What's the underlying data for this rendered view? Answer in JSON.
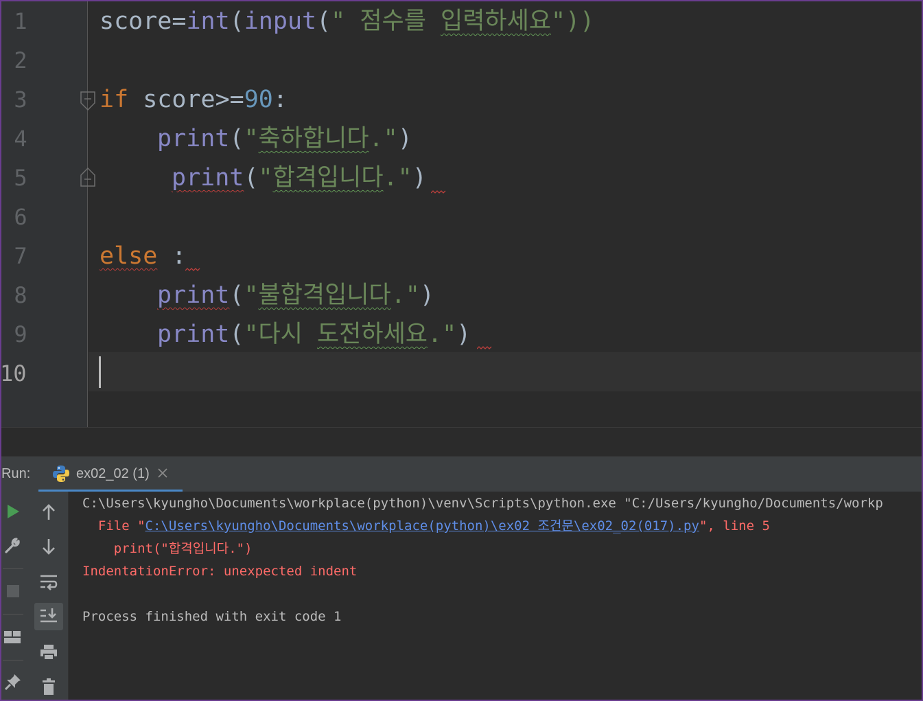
{
  "editor": {
    "line_numbers": [
      "1",
      "2",
      "3",
      "4",
      "5",
      "6",
      "7",
      "8",
      "9",
      "10"
    ],
    "current_line": "10",
    "lines": {
      "l1": {
        "a": "score=",
        "b": "int",
        "c": "(",
        "d": "input",
        "e": "(",
        "f": "\" 점수를 ",
        "g": "입력하세요",
        "h": "\"))"
      },
      "l3": {
        "a": "if",
        "b": " score>=",
        "c": "90",
        "d": ":"
      },
      "l4": {
        "a": "print",
        "b": "(",
        "c": "\"",
        "d": "축하합니다",
        "e": ".\"",
        "f": ")"
      },
      "l5": {
        "a": "print",
        "b": "(",
        "c": "\"",
        "d": "합격입니다",
        "e": ".\"",
        "f": ")"
      },
      "l7": {
        "a": "else",
        "b": " ",
        "c": ":"
      },
      "l8": {
        "a": "print",
        "b": "(",
        "c": "\"",
        "d": "불합격입니다",
        "e": ".\"",
        "f": ")"
      },
      "l9": {
        "a": "print",
        "b": "(",
        "c": "\"다시 ",
        "d": "도전하세요",
        "e": ".\"",
        "f": ")"
      }
    }
  },
  "run_panel": {
    "label": "Run:",
    "tab_label": "ex02_02 (1)",
    "icons": {
      "rerun": "play-icon",
      "settings": "wrench-icon",
      "stop": "stop-icon",
      "layout": "layout-icon",
      "pin": "pin-icon",
      "up": "arrow-up-icon",
      "down": "arrow-down-icon",
      "wrap": "soft-wrap-icon",
      "scroll_end": "scroll-to-end-icon",
      "print": "print-icon",
      "clear": "trash-icon"
    }
  },
  "console": {
    "line1": "C:\\Users\\kyungho\\Documents\\workplace(python)\\venv\\Scripts\\python.exe \"C:/Users/kyungho/Documents/workp",
    "line2_prefix": "  File \"",
    "line2_link": "C:\\Users\\kyungho\\Documents\\workplace(python)\\ex02 조건문\\ex02_02(017).py",
    "line2_suffix": "\", line 5",
    "line3": "    print(\"합격입니다.\")",
    "line4": "IndentationError: unexpected indent",
    "line5": "Process finished with exit code 1"
  },
  "colors": {
    "keyword": "#cc7832",
    "builtin": "#8888c6",
    "number": "#6897bb",
    "string": "#6a8759",
    "error_text": "#ff6b68",
    "link": "#5f8ee8",
    "run_green": "#499c54",
    "tab_underline": "#4a88c7"
  }
}
